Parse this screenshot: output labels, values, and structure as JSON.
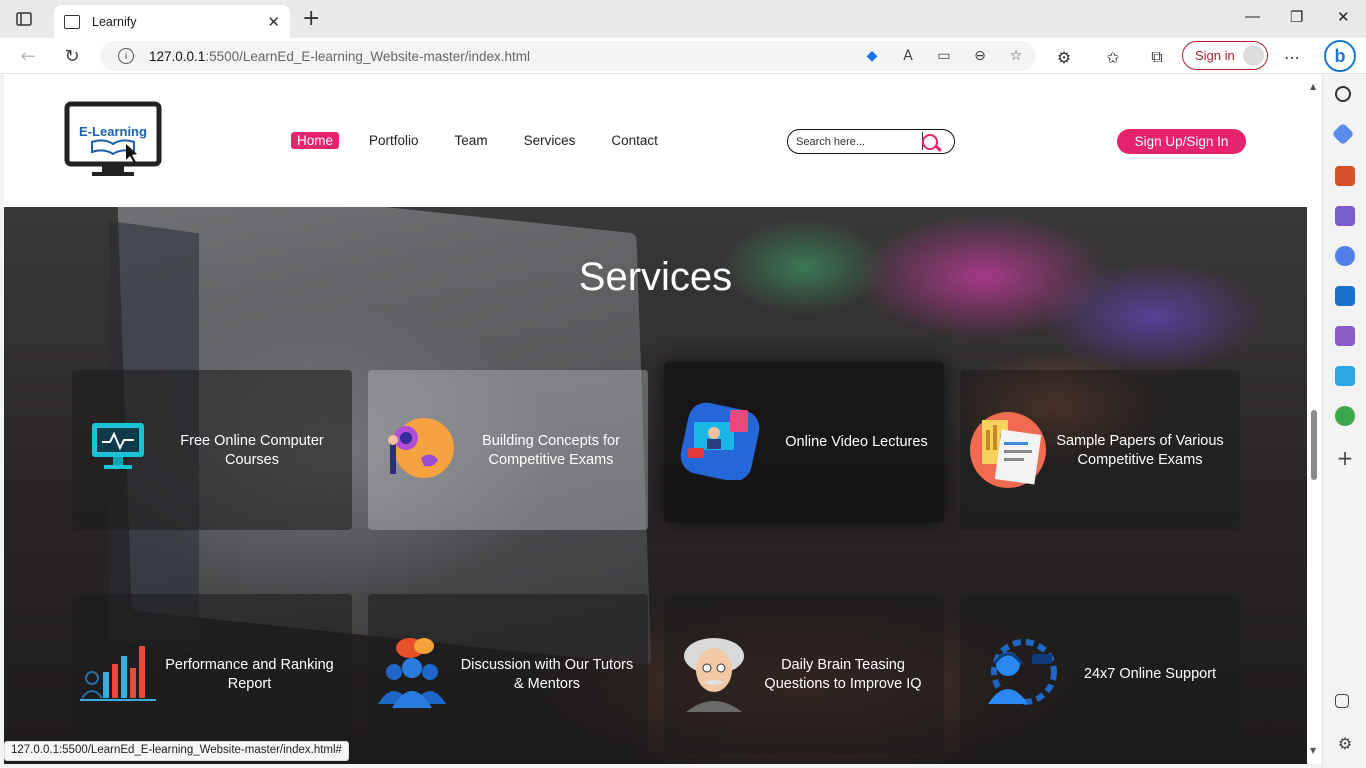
{
  "browser": {
    "tab_title": "Learnify",
    "url_host": "127.0.0.1",
    "url_rest": ":5500/LearnEd_E-learning_Website-master/index.html",
    "signin_label": "Sign in",
    "status_url": "127.0.0.1:5500/LearnEd_E-learning_Website-master/index.html#"
  },
  "site": {
    "logo_text": "E-Learning",
    "nav": [
      "Home",
      "Portfolio",
      "Team",
      "Services",
      "Contact"
    ],
    "search_placeholder": "Search here...",
    "signup_label": "Sign Up/Sign In",
    "accent": "#e6246d"
  },
  "services": {
    "title": "Services",
    "cards": [
      {
        "label_1": "Free Online Computer",
        "label_2": "Courses",
        "icon": "computer-course-icon"
      },
      {
        "label_1": "Building Concepts for",
        "label_2": "Competitive Exams",
        "icon": "concept-building-icon"
      },
      {
        "label_1": "Online Video Lectures",
        "label_2": "",
        "icon": "video-lecture-icon"
      },
      {
        "label_1": "Sample Papers of Various",
        "label_2": "Competitive Exams",
        "icon": "sample-papers-icon"
      },
      {
        "label_1": "Performance and Ranking",
        "label_2": "Report",
        "icon": "ranking-chart-icon"
      },
      {
        "label_1": "Discussion with Our Tutors",
        "label_2": "& Mentors",
        "icon": "discussion-group-icon"
      },
      {
        "label_1": "Daily Brain Teasing",
        "label_2": "Questions to Improve IQ",
        "icon": "einstein-icon"
      },
      {
        "label_1": "24x7 Online Support",
        "label_2": "",
        "icon": "support-headset-icon"
      }
    ]
  }
}
